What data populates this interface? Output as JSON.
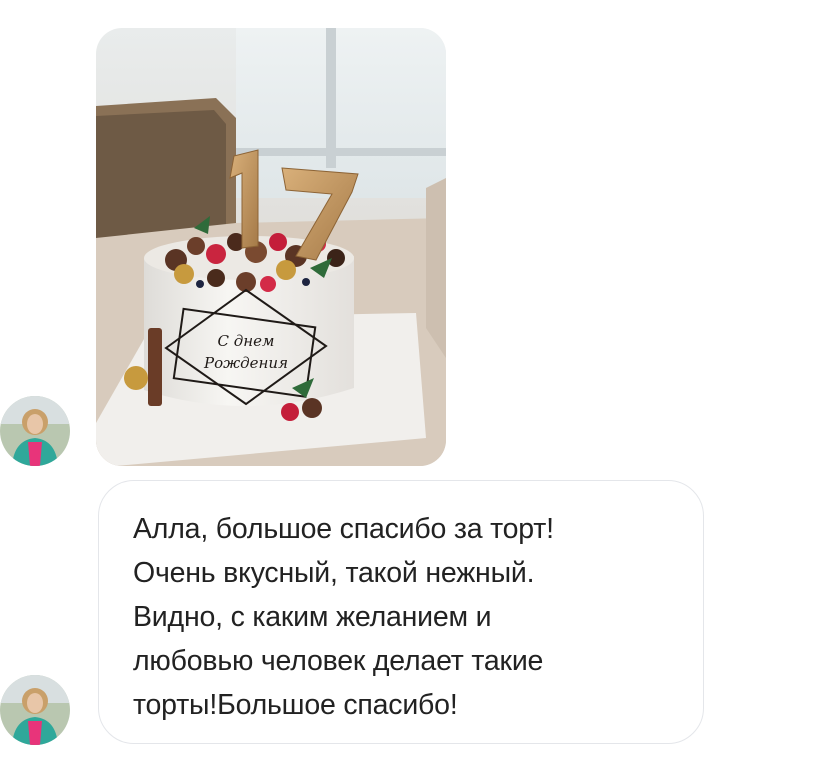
{
  "conversation": {
    "photo_message": {
      "description_icon": "cake-photo",
      "cake_topper_number": "17",
      "cake_topper_text_top": "С днем",
      "cake_topper_text_bottom": "Рождения"
    },
    "text_message": {
      "lines": [
        "Алла, большое спасибо за торт!",
        "Очень вкусный, такой нежный.",
        "Видно, с каким желанием и",
        "любовью человек делает такие",
        "торты!Большое спасибо!"
      ]
    },
    "sender": {
      "avatar_icon": "user-avatar"
    }
  },
  "colors": {
    "bubble_border": "#e4e6ea",
    "text": "#222222",
    "background": "#ffffff"
  }
}
